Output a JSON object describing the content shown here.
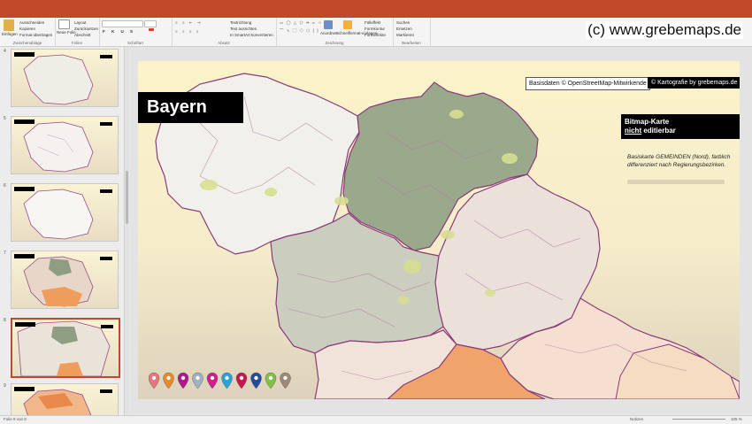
{
  "ribbon": {
    "paste_label": "Einfügen",
    "cut_label": "Ausschneiden",
    "copy_label": "Kopieren",
    "format_painter_label": "Format übertragen",
    "new_slide_label": "Neue Folie",
    "layout_label": "Layout",
    "reset_label": "Zurücksetzen",
    "section_label": "Abschnitt",
    "groups": [
      "Zwischenablage",
      "Folien",
      "Schriftart",
      "Absatz",
      "Zeichnung",
      "Bearbeiten"
    ],
    "text_direction_label": "Textrichtung",
    "align_text_label": "Text ausrichten",
    "smartart_label": "In SmartArt konvertieren",
    "arrange_label": "Anordnen",
    "quick_styles_label": "Schnellformat-vorlagen",
    "fill_label": "Fülleffekt",
    "outline_label": "Formkontur",
    "effects_label": "Formeffekte",
    "find_label": "Suchen",
    "replace_label": "Ersetzen",
    "select_label": "Markieren"
  },
  "watermark": "(c) www.grebemaps.de",
  "thumbnails": [
    {
      "num": "4"
    },
    {
      "num": "5"
    },
    {
      "num": "6"
    },
    {
      "num": "7"
    },
    {
      "num": "8",
      "selected": true
    },
    {
      "num": "9"
    }
  ],
  "slide": {
    "title": "Bayern",
    "attribution_left": "Basisdaten © OpenStreetMap-Mitwirkende",
    "attribution_right": "© Kartografie by grebemaps.de",
    "info_line1": "Bitmap-Karte",
    "info_line2_u": "nicht",
    "info_line2_rest": " editierbar",
    "description": "Basiskarte GEMEINDEN (Nord), farblich differenziert nach Regierungsbezirken.",
    "pin_colors": [
      "#e5767c",
      "#e88a2a",
      "#b2178f",
      "#9fb0c0",
      "#d21c8e",
      "#2aa2d8",
      "#c8174e",
      "#244c9b",
      "#7fc242",
      "#9c8a74"
    ]
  },
  "status": {
    "slide_info": "Folie 8 von 8",
    "notes_label": "Notizen",
    "zoom": "105 %"
  },
  "colors": {
    "accent": "#c0492a",
    "region_oberfranken": "#9ba88c",
    "region_oberpfalz": "#ece0dc",
    "region_mittelfranken": "#cbcdbe",
    "region_unterfranken": "#f3f1ea",
    "region_niederbayern": "#f6dfcf",
    "region_oberbayern": "#f0a46a"
  }
}
